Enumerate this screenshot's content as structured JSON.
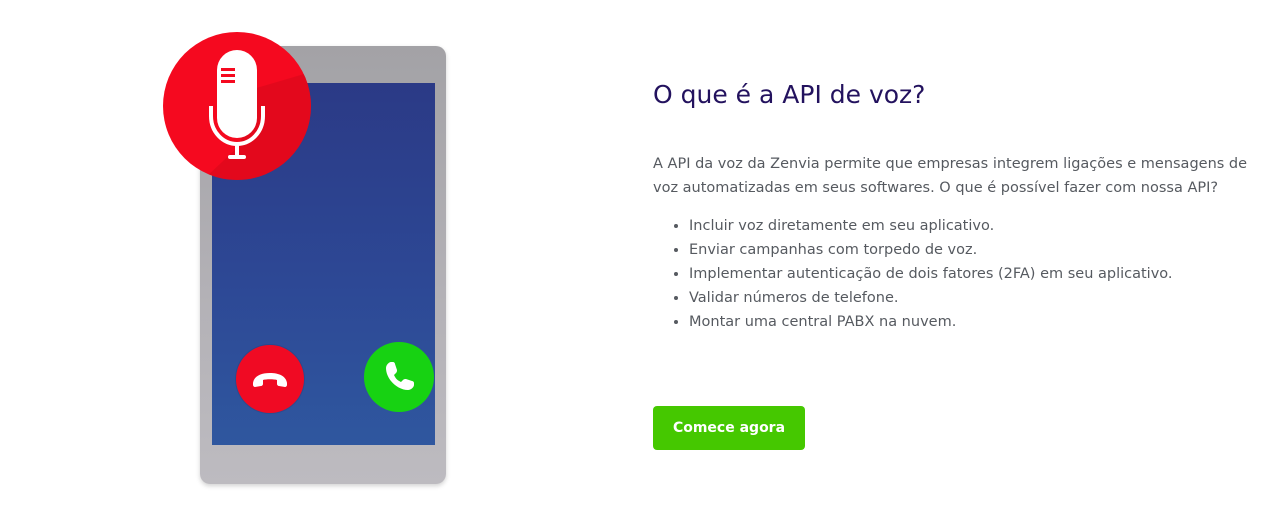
{
  "section": {
    "title": "O que é a API de voz?",
    "intro": "A API da voz da Zenvia permite que empresas integrem ligações e mensagens de voz automatizadas em seus softwares. O que é possível fazer com nossa API?",
    "features": [
      "Incluir voz diretamente em seu aplicativo.",
      "Enviar campanhas com torpedo de voz.",
      "Implementar autenticação de dois fatores (2FA) em seu aplicativo.",
      "Validar números de telefone.",
      "Montar uma central PABX na nuvem."
    ],
    "cta_label": "Comece agora"
  },
  "illustration": {
    "icons": [
      "microphone-icon",
      "decline-call-icon",
      "accept-call-icon"
    ],
    "colors": {
      "mic_badge": "#f5091f",
      "decline": "#f00a23",
      "accept": "#17d212",
      "screen": "#2d4895",
      "phone_body": "#b4b2b7"
    }
  },
  "colors": {
    "title": "#23125e",
    "body_text": "#565a60",
    "cta_background": "#45c800",
    "cta_text": "#ffffff"
  }
}
